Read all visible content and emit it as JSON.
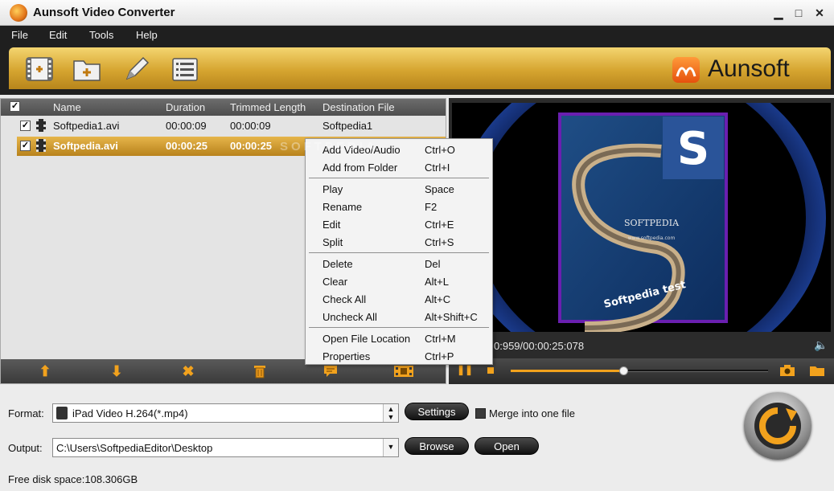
{
  "window": {
    "title": "Aunsoft Video Converter",
    "controls": {
      "minimize": "▁",
      "maximize": "□",
      "close": "✕"
    }
  },
  "menu": [
    "File",
    "Edit",
    "Tools",
    "Help"
  ],
  "toolbar": {
    "buttons": [
      "add-video-icon",
      "add-folder-icon",
      "edit-pencil-icon",
      "task-list-icon"
    ],
    "brand": "Aunsoft"
  },
  "file_list": {
    "columns": [
      "Name",
      "Duration",
      "Trimmed Length",
      "Destination File"
    ],
    "rows": [
      {
        "name": "Softpedia1.avi",
        "duration": "00:00:09",
        "trimmed": "00:00:09",
        "destination": "Softpedia1",
        "checked": true,
        "selected": false
      },
      {
        "name": "Softpedia.avi",
        "duration": "00:00:25",
        "trimmed": "00:00:25",
        "destination": "",
        "checked": true,
        "selected": true
      }
    ],
    "footer_buttons": [
      "move-up-icon",
      "move-down-icon",
      "remove-icon",
      "clear-trash-icon",
      "comment-icon",
      "merge-film-icon"
    ]
  },
  "context_menu": {
    "groups": [
      [
        {
          "label": "Add Video/Audio",
          "shortcut": "Ctrl+O"
        },
        {
          "label": "Add from Folder",
          "shortcut": "Ctrl+I"
        }
      ],
      [
        {
          "label": "Play",
          "shortcut": "Space"
        },
        {
          "label": "Rename",
          "shortcut": "F2"
        },
        {
          "label": "Edit",
          "shortcut": "Ctrl+E"
        },
        {
          "label": "Split",
          "shortcut": "Ctrl+S"
        }
      ],
      [
        {
          "label": "Delete",
          "shortcut": "Del"
        },
        {
          "label": "Clear",
          "shortcut": "Alt+L"
        },
        {
          "label": "Check All",
          "shortcut": "Alt+C"
        },
        {
          "label": "Uncheck All",
          "shortcut": "Alt+Shift+C"
        }
      ],
      [
        {
          "label": "Open File Location",
          "shortcut": "Ctrl+M"
        },
        {
          "label": "Properties",
          "shortcut": "Ctrl+P"
        }
      ]
    ]
  },
  "preview": {
    "time": "0:959/00:00:25:078",
    "image_text": {
      "logo_letter": "S",
      "caption": "SOFTPEDIA",
      "url": "www.softpedia.com",
      "banner": "Softpedia test"
    },
    "progress": 0.44,
    "watermark": "SOFTPEDIA"
  },
  "settings": {
    "format_label": "Format:",
    "format_value": "iPad Video H.264(*.mp4)",
    "settings_button": "Settings",
    "merge_label": "Merge into one file",
    "merge_checked": false,
    "output_label": "Output:",
    "output_value": "C:\\Users\\SoftpediaEditor\\Desktop",
    "browse_button": "Browse",
    "open_button": "Open",
    "disk_space": "Free disk space:108.306GB"
  },
  "colors": {
    "accent_gold": "#d6a530",
    "selection": "#c18d24",
    "dark_panel": "#2b2b2b",
    "brand_orange": "#e6510d"
  }
}
